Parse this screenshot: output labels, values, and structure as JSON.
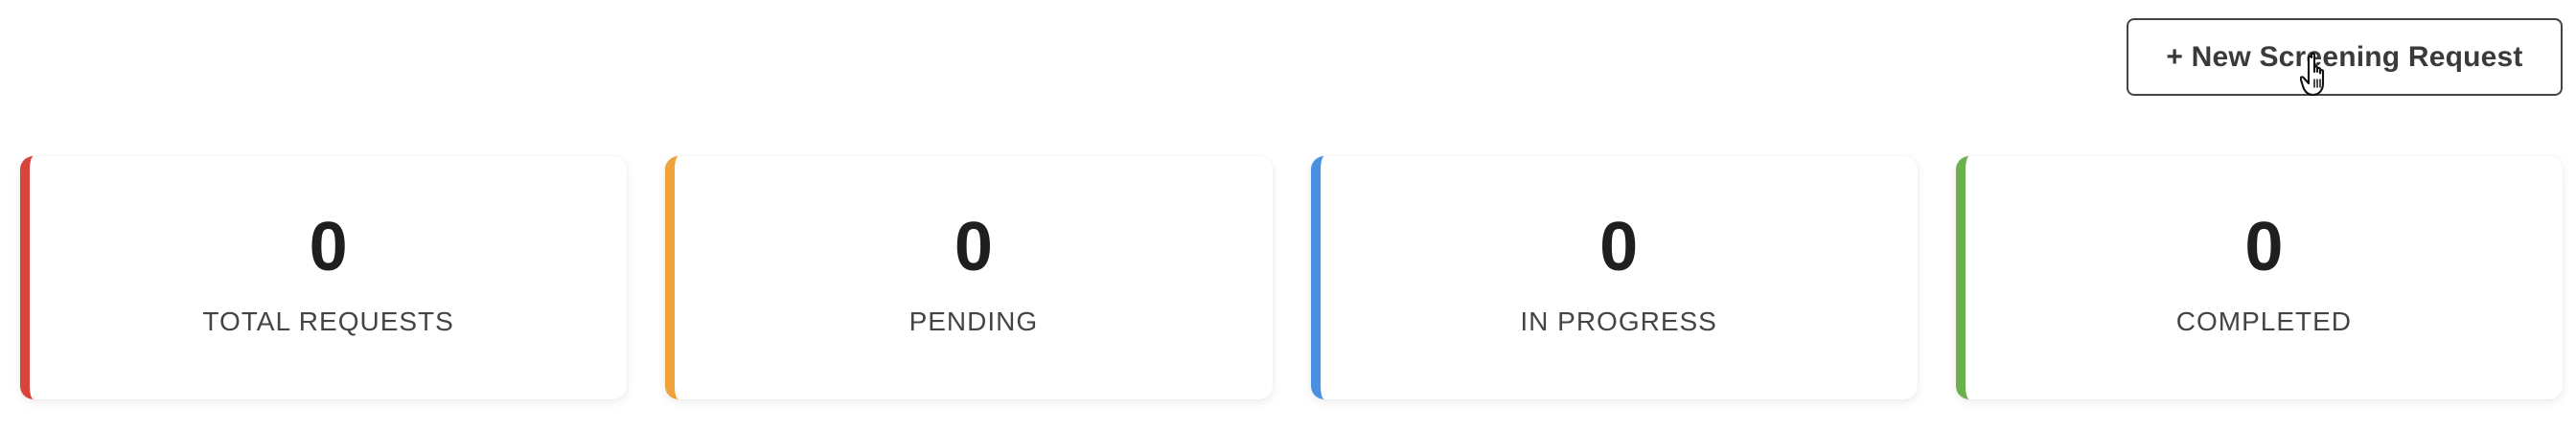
{
  "header": {
    "new_request_label": "+ New Screening Request"
  },
  "stats": [
    {
      "value": "0",
      "label": "TOTAL REQUESTS",
      "accent": "#d9443a"
    },
    {
      "value": "0",
      "label": "PENDING",
      "accent": "#f0a23a"
    },
    {
      "value": "0",
      "label": "IN PROGRESS",
      "accent": "#4a90e2"
    },
    {
      "value": "0",
      "label": "COMPLETED",
      "accent": "#6ab04c"
    }
  ],
  "icons": {
    "cursor": "hand-pointer-cursor-icon"
  }
}
